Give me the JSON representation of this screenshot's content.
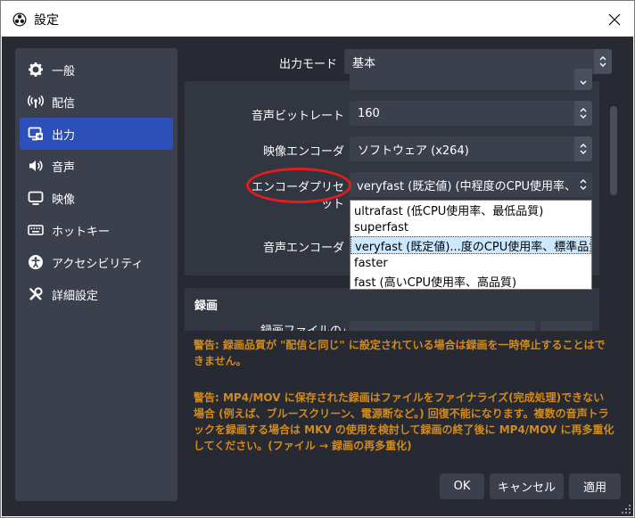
{
  "window": {
    "title": "設定"
  },
  "sidebar": {
    "items": [
      {
        "label": "一般",
        "icon": "gear-icon"
      },
      {
        "label": "配信",
        "icon": "broadcast-icon"
      },
      {
        "label": "出力",
        "icon": "output-icon",
        "active": true
      },
      {
        "label": "音声",
        "icon": "speaker-icon"
      },
      {
        "label": "映像",
        "icon": "monitor-icon"
      },
      {
        "label": "ホットキー",
        "icon": "keyboard-icon"
      },
      {
        "label": "アクセシビリティ",
        "icon": "accessibility-icon"
      },
      {
        "label": "詳細設定",
        "icon": "tools-icon"
      }
    ]
  },
  "output": {
    "mode_label": "出力モード",
    "mode_value": "基本",
    "audio_bitrate_label": "音声ビットレート",
    "audio_bitrate_value": "160",
    "video_encoder_label": "映像エンコーダ",
    "video_encoder_value": "ソフトウェア (x264)",
    "preset_label": "エンコーダプリセット",
    "preset_value": "veryfast (既定値) (中程度のCPU使用率、標",
    "audio_encoder_label": "音声エンコーダ"
  },
  "preset_options": [
    "ultrafast (低CPU使用率、最低品質)",
    "superfast",
    "veryfast (既定値)...度のCPU使用率、標準品質)",
    "faster",
    "fast (高いCPU使用率、高品質)"
  ],
  "recording": {
    "header": "録画",
    "path_label_partial": "録画ファイルのパス"
  },
  "warnings": {
    "w1": "警告: 録画品質が \"配信と同じ\" に設定されている場合は録画を一時停止することはできません。",
    "w2": "警告: MP4/MOV に保存された録画はファイルをファイナライズ(完成処理)できない場合 (例えば、ブルースクリーン、電源断など。) 回復不能になります。複数の音声トラックを録画する場合は MKV の使用を検討して録画の終了後に MP4/MOV に再多重化してください。(ファイル → 録画の再多重化)"
  },
  "buttons": {
    "ok": "OK",
    "cancel": "キャンセル",
    "apply": "適用"
  },
  "colors": {
    "accent": "#2c4fba",
    "warning": "#d18a1e",
    "annotation": "#e31d1d"
  }
}
